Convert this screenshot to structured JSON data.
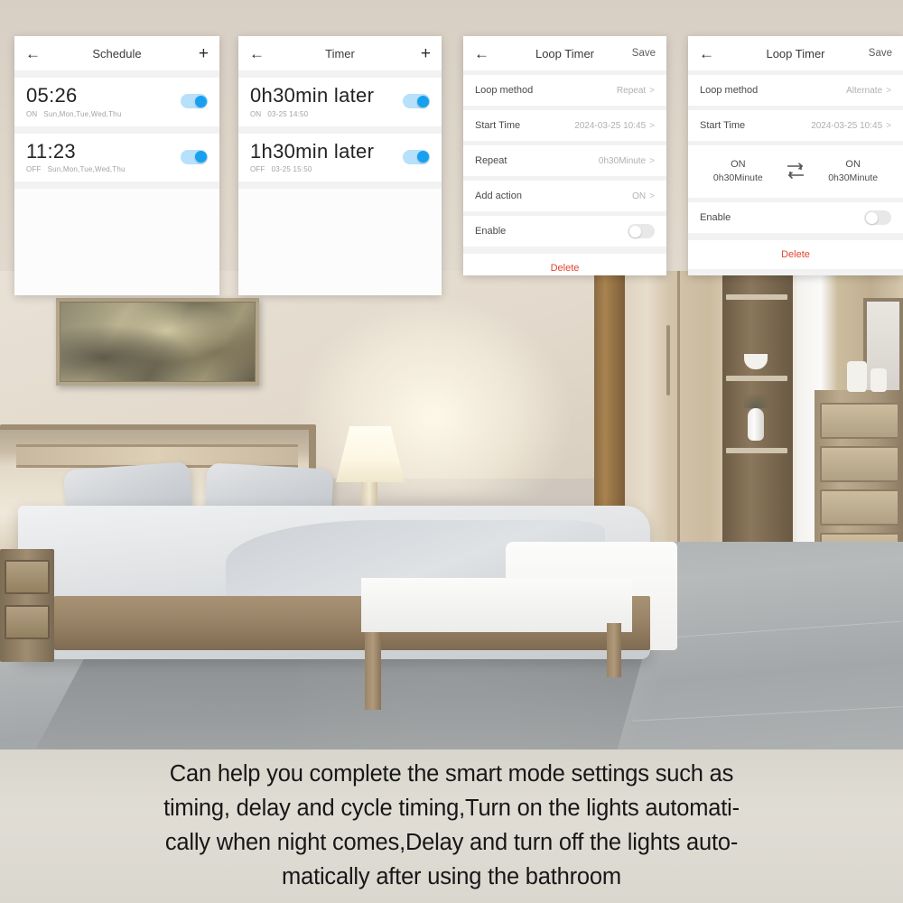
{
  "panels": [
    {
      "id": "schedule",
      "nav": {
        "back_icon": "arrow-left-icon",
        "title": "Schedule",
        "action": "+"
      },
      "rows": [
        {
          "time": "05:26",
          "state": "ON",
          "days": "Sun,Mon,Tue,Wed,Thu",
          "toggle": "on"
        },
        {
          "time": "11:23",
          "state": "OFF",
          "days": "Sun,Mon,Tue,Wed,Thu",
          "toggle": "on"
        }
      ]
    },
    {
      "id": "timer",
      "nav": {
        "back_icon": "arrow-left-icon",
        "title": "Timer",
        "action": "+"
      },
      "rows": [
        {
          "time": "0h30min later",
          "state": "ON",
          "days": "03-25 14:50",
          "toggle": "on"
        },
        {
          "time": "1h30min later",
          "state": "OFF",
          "days": "03-25 15:50",
          "toggle": "on"
        }
      ]
    },
    {
      "id": "loop-timer-repeat",
      "nav": {
        "back_icon": "arrow-left-icon",
        "title": "Loop Timer",
        "action": "Save"
      },
      "settings": [
        {
          "label": "Loop method",
          "value": "Repeat",
          "chevron": ">"
        },
        {
          "label": "Start Time",
          "value": "2024-03-25 10:45",
          "chevron": ">"
        },
        {
          "label": "Repeat",
          "value": "0h30Minute",
          "chevron": ">"
        },
        {
          "label": "Add action",
          "value": "ON",
          "chevron": ">"
        }
      ],
      "enable": {
        "label": "Enable",
        "toggle": "off"
      },
      "delete": "Delete"
    },
    {
      "id": "loop-timer-alternate",
      "nav": {
        "back_icon": "arrow-left-icon",
        "title": "Loop Timer",
        "action": "Save"
      },
      "settings": [
        {
          "label": "Loop method",
          "value": "Alternate",
          "chevron": ">"
        },
        {
          "label": "Start Time",
          "value": "2024-03-25 10:45",
          "chevron": ">"
        }
      ],
      "alternate": {
        "left": {
          "state": "ON",
          "duration": "0h30Minute"
        },
        "icon": "loop-arrows-icon",
        "right": {
          "state": "ON",
          "duration": "0h30Minute"
        }
      },
      "enable": {
        "label": "Enable",
        "toggle": "off"
      },
      "delete": "Delete"
    }
  ],
  "caption": {
    "line1": "Can help you complete the smart mode settings such as",
    "line2": "timing, delay and cycle timing,Turn on the lights automati-",
    "line3": "cally when night comes,Delay and turn off the lights auto-",
    "line4": "matically after using the bathroom"
  },
  "colors": {
    "toggle_on_track": "#b7e0fb",
    "toggle_on_knob": "#18a0f0",
    "toggle_off_track": "#e8e8e8",
    "delete_text": "#e0452f",
    "panel_bg": "#fcfcfc"
  }
}
